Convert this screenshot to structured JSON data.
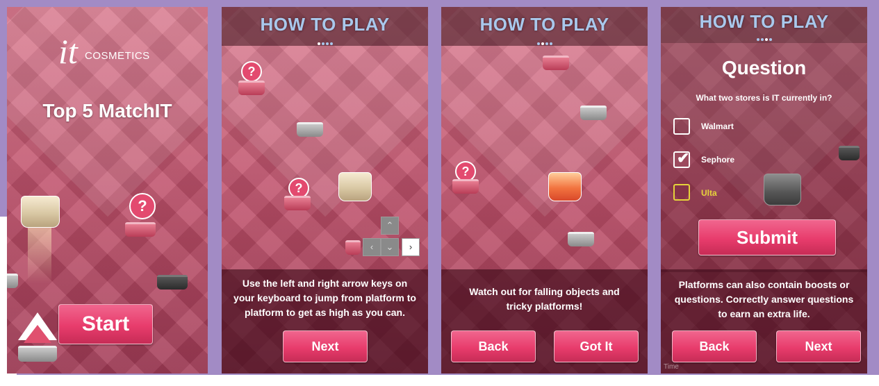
{
  "brand": {
    "logo_glyph": "it",
    "logo_text": "COSMETICS"
  },
  "screen1": {
    "title": "Top 5 MatchIT",
    "start_label": "Start",
    "question_mark": "?"
  },
  "header": {
    "title": "HOW TO PLAY"
  },
  "screen2": {
    "instruction": "Use the left and right arrow keys on your keyboard to jump from platform to platform to get as high as you can.",
    "next_label": "Next",
    "question_mark": "?",
    "keys": {
      "up": "⌃",
      "left": "‹",
      "down": "⌄",
      "right": "›"
    }
  },
  "screen3": {
    "instruction": "Watch out for falling objects and tricky platforms!",
    "back_label": "Back",
    "gotit_label": "Got It",
    "question_mark": "?"
  },
  "screen4": {
    "question_title": "Question",
    "question_text": "What two stores is IT currently in?",
    "options": [
      {
        "label": "Walmart",
        "checked": false
      },
      {
        "label": "Sephore",
        "checked": true
      },
      {
        "label": "Ulta",
        "checked": false
      }
    ],
    "submit_label": "Submit",
    "info": "Platforms can also contain boosts or questions. Correctly answer questions to earn an extra life.",
    "back_label": "Back",
    "next_label": "Next",
    "corner_text": "Time"
  },
  "colors": {
    "accent": "#e83c6c",
    "header_text": "#a9c8ec",
    "frame": "#a28bc5",
    "checkbox_yellow": "#e5d33a"
  },
  "icons": [
    "question-mark-icon",
    "arrow-up-icon",
    "arrow-left-icon",
    "arrow-down-icon",
    "arrow-right-icon",
    "check-icon",
    "page-dots-icon"
  ]
}
